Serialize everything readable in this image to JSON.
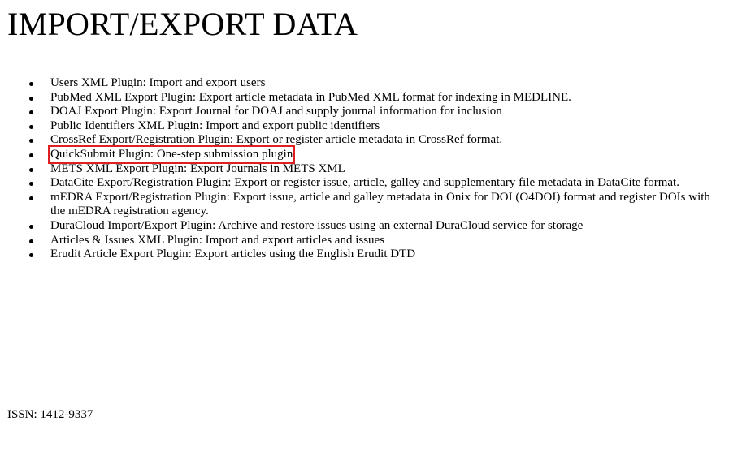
{
  "page": {
    "title": "IMPORT/EXPORT DATA"
  },
  "plugins": [
    {
      "text": "Users XML Plugin: Import and export users"
    },
    {
      "text": "PubMed XML Export Plugin: Export article metadata in PubMed XML format for indexing in MEDLINE."
    },
    {
      "text": "DOAJ Export Plugin: Export Journal for DOAJ and supply journal information for inclusion"
    },
    {
      "text": "Public Identifiers XML Plugin: Import and export public identifiers"
    },
    {
      "text": "CrossRef Export/Registration Plugin: Export or register article metadata in CrossRef format."
    },
    {
      "text": "QuickSubmit Plugin: One-step submission plugin",
      "highlighted": true
    },
    {
      "text": "METS XML Export Plugin: Export Journals in METS XML"
    },
    {
      "text": "DataCite Export/Registration Plugin: Export or register issue, article, galley and supplementary file metadata in DataCite format."
    },
    {
      "text": "mEDRA Export/Registration Plugin: Export issue, article and galley metadata in Onix for DOI (O4DOI) format and register DOIs with the mEDRA registration agency."
    },
    {
      "text": "DuraCloud Import/Export Plugin: Archive and restore issues using an external DuraCloud service for storage"
    },
    {
      "text": "Articles & Issues XML Plugin: Import and export articles and issues"
    },
    {
      "text": "Erudit Article Export Plugin: Export articles using the English Erudit DTD"
    }
  ],
  "footer": {
    "issn": "ISSN: 1412-9337"
  },
  "colors": {
    "highlight_box": "#e02020",
    "divider": "#2e7d32",
    "text": "#000000",
    "background": "#ffffff"
  }
}
